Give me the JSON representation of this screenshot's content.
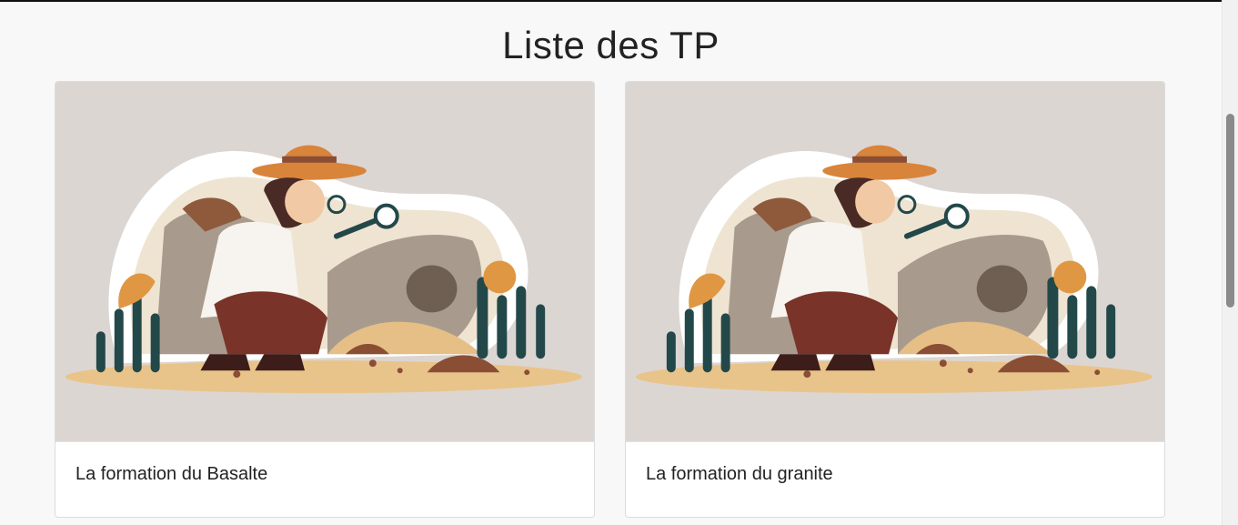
{
  "page": {
    "title": "Liste des TP"
  },
  "cards": [
    {
      "title": "La formation du Basalte",
      "image_icon": "geologist-illustration"
    },
    {
      "title": "La formation du granite",
      "image_icon": "geologist-illustration"
    }
  ],
  "colors": {
    "background": "#f8f8f8",
    "card_border": "#dcdcdc",
    "image_bg": "#dcd6d3",
    "hat": "#d9843b",
    "sand": "#e9c48a",
    "cactus": "#23484a",
    "rock": "#a89b8e"
  }
}
